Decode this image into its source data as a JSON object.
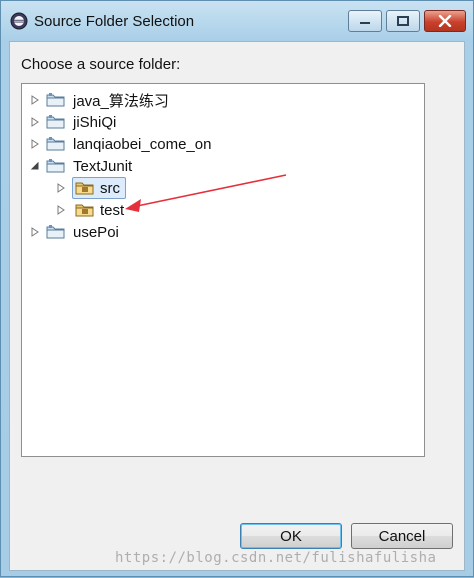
{
  "window": {
    "title": "Source Folder Selection"
  },
  "dialog": {
    "prompt": "Choose a source folder:"
  },
  "tree": {
    "items": [
      {
        "label": "java_算法练习",
        "expanded": false,
        "level": 0,
        "icon": "project-folder-icon"
      },
      {
        "label": "jiShiQi",
        "expanded": false,
        "level": 0,
        "icon": "project-folder-icon"
      },
      {
        "label": "lanqiaobei_come_on",
        "expanded": false,
        "level": 0,
        "icon": "project-folder-icon"
      },
      {
        "label": "TextJunit",
        "expanded": true,
        "level": 0,
        "icon": "project-folder-icon"
      },
      {
        "label": "src",
        "expanded": false,
        "level": 1,
        "icon": "package-folder-icon",
        "selected": true
      },
      {
        "label": "test",
        "expanded": false,
        "level": 1,
        "icon": "package-folder-icon"
      },
      {
        "label": "usePoi",
        "expanded": false,
        "level": 0,
        "icon": "project-folder-icon"
      }
    ]
  },
  "buttons": {
    "ok": "OK",
    "cancel": "Cancel"
  },
  "watermark": "https://blog.csdn.net/fulishafulisha",
  "colors": {
    "annotation_arrow": "#e5303a",
    "selection_bg": "#dcecfc",
    "window_frame": "#a9cfe8"
  }
}
